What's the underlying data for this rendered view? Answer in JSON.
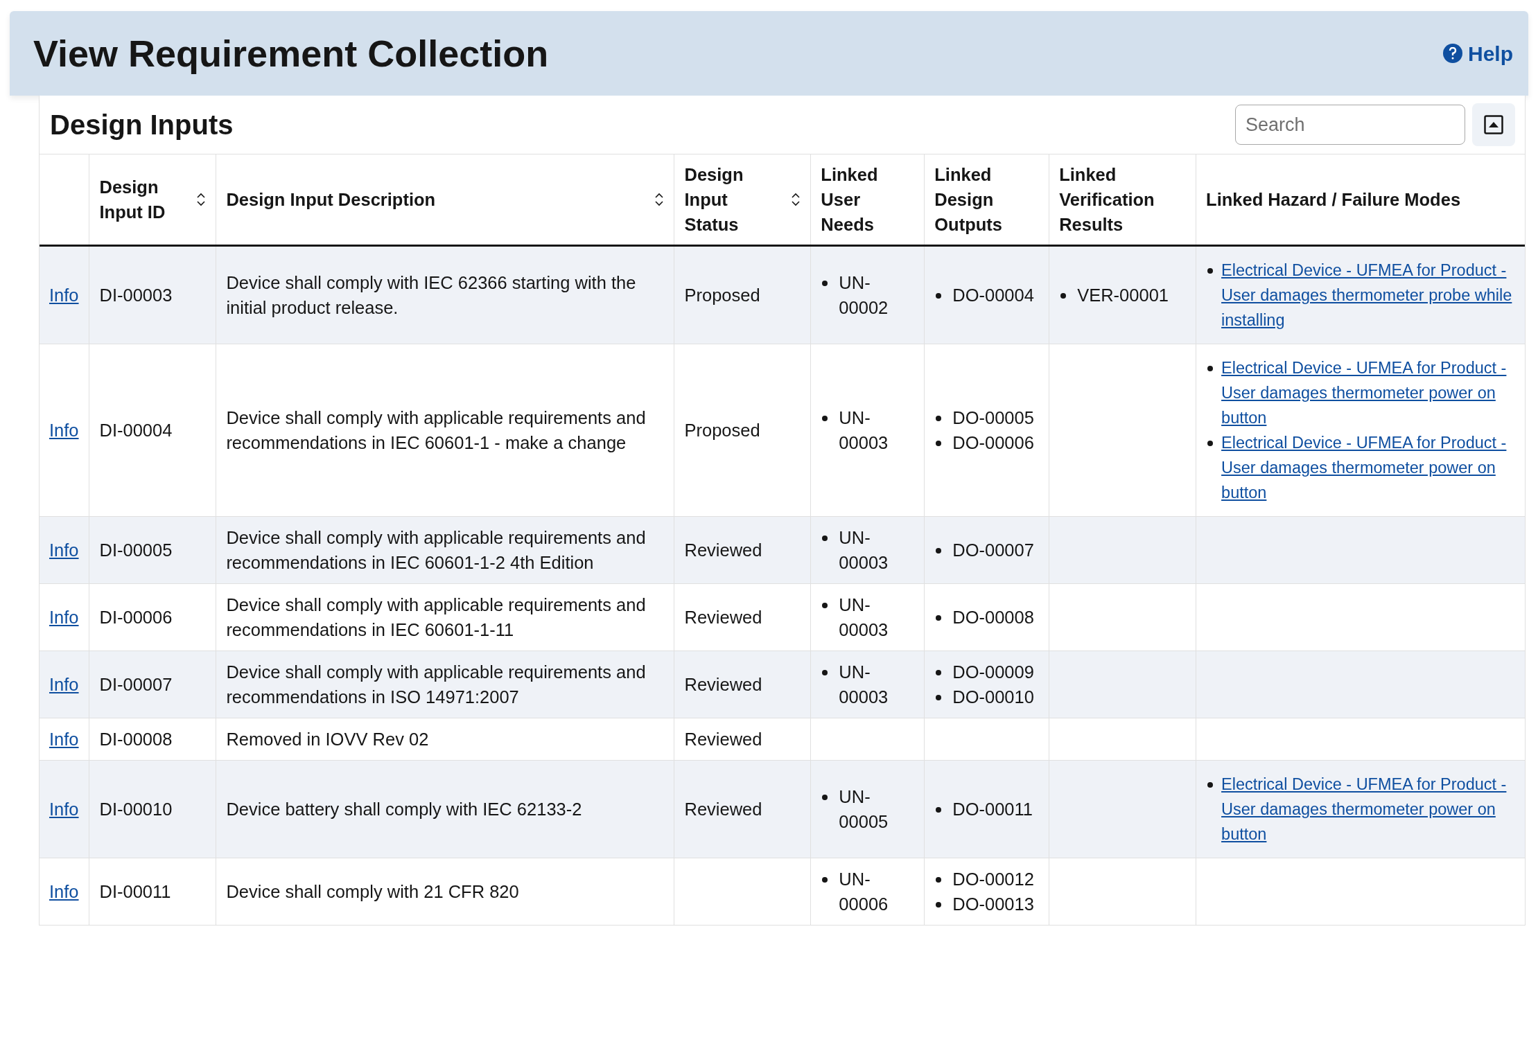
{
  "page_header": {
    "title": "View Requirement Collection",
    "help_link": "Help"
  },
  "section": {
    "title": "Design Inputs",
    "search": {
      "placeholder": "Search"
    }
  },
  "table": {
    "columns": [
      {
        "sortable": false
      },
      {
        "label": "Design Input ID",
        "sortable": true
      },
      {
        "label": "Design Input Description",
        "sortable": true
      },
      {
        "label": "Design Input Status",
        "sortable": true
      },
      {
        "label": "Linked User Needs",
        "sortable": false
      },
      {
        "label": "Linked Design Outputs",
        "sortable": false
      },
      {
        "label": "Linked Verification Results",
        "sortable": false
      },
      {
        "label": "Linked Hazard / Failure Modes",
        "sortable": false
      }
    ],
    "rows": [
      {
        "info": "Info",
        "id": "DI-00003",
        "description": "Device shall comply with IEC 62366 starting with the initial product release.",
        "status": "Proposed",
        "user_needs": [
          "UN-00002"
        ],
        "design_outputs": [
          "DO-00004"
        ],
        "verification_results": [
          "VER-00001"
        ],
        "hazards": [
          "Electrical Device - UFMEA for Product - User damages thermometer probe while installing"
        ]
      },
      {
        "info": "Info",
        "id": "DI-00004",
        "description": "Device shall comply with applicable requirements and recommendations in IEC 60601-1 - make a change",
        "status": "Proposed",
        "user_needs": [
          "UN-00003"
        ],
        "design_outputs": [
          "DO-00005",
          "DO-00006"
        ],
        "verification_results": [],
        "hazards": [
          "Electrical Device - UFMEA for Product - User damages thermometer power on button",
          "Electrical Device - UFMEA for Product - User damages thermometer power on button"
        ]
      },
      {
        "info": "Info",
        "id": "DI-00005",
        "description": "Device shall comply with applicable requirements and recommendations in IEC 60601-1-2 4th Edition",
        "status": "Reviewed",
        "user_needs": [
          "UN-00003"
        ],
        "design_outputs": [
          "DO-00007"
        ],
        "verification_results": [],
        "hazards": []
      },
      {
        "info": "Info",
        "id": "DI-00006",
        "description": "Device shall comply with applicable requirements and recommendations in IEC 60601-1-11",
        "status": "Reviewed",
        "user_needs": [
          "UN-00003"
        ],
        "design_outputs": [
          "DO-00008"
        ],
        "verification_results": [],
        "hazards": []
      },
      {
        "info": "Info",
        "id": "DI-00007",
        "description": "Device shall comply with applicable requirements and recommendations in ISO 14971:2007",
        "status": "Reviewed",
        "user_needs": [
          "UN-00003"
        ],
        "design_outputs": [
          "DO-00009",
          "DO-00010"
        ],
        "verification_results": [],
        "hazards": []
      },
      {
        "info": "Info",
        "id": "DI-00008",
        "description": "Removed in IOVV Rev 02",
        "status": "Reviewed",
        "user_needs": [],
        "design_outputs": [],
        "verification_results": [],
        "hazards": []
      },
      {
        "info": "Info",
        "id": "DI-00010",
        "description": "Device battery shall comply with IEC 62133-2",
        "status": "Reviewed",
        "user_needs": [
          "UN-00005"
        ],
        "design_outputs": [
          "DO-00011"
        ],
        "verification_results": [],
        "hazards": [
          "Electrical Device - UFMEA for Product - User damages thermometer power on button"
        ]
      },
      {
        "info": "Info",
        "id": "DI-00011",
        "description": "Device shall comply with 21 CFR 820",
        "user_needs": [
          "UN-00006"
        ],
        "design_outputs": [
          "DO-00012",
          "DO-00013"
        ],
        "verification_results": [],
        "hazards": []
      }
    ]
  }
}
